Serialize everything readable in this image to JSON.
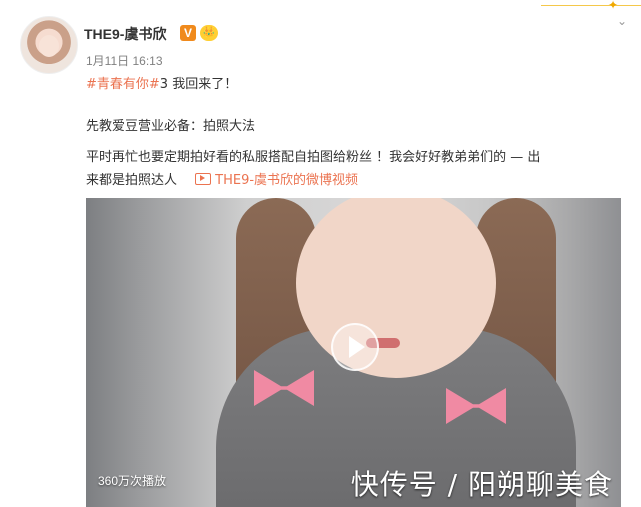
{
  "profile": {
    "username": "THE9-虞书欣",
    "verified_badge": "V",
    "crown_badge": "👑",
    "time": "1月11日 16:13"
  },
  "post": {
    "line1_hashtag": "#青春有你#",
    "line1_text": "3 我回来了！",
    "line2": "先教爱豆营业必备：拍照大法",
    "line3": "平时再忙也要定期拍好看的私服搭配自拍图给粉丝 ！我会好好教弟弟们的 — 出",
    "line4_text": "来都是拍照达人",
    "video_link": "THE9-虞书欣的微博视频"
  },
  "video": {
    "view_count": "360万次播放",
    "watermark": "快传号 / 阳朔聊美食"
  },
  "colors": {
    "accent": "#eb7350",
    "verified": "#f08a1c"
  }
}
